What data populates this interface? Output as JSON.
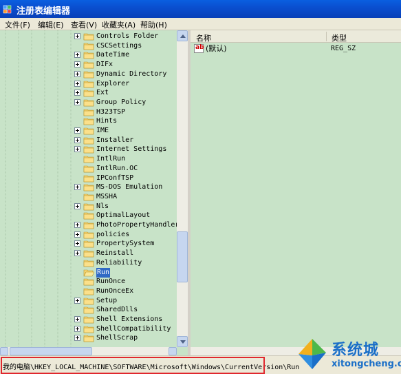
{
  "window": {
    "title": "注册表编辑器"
  },
  "menu": [
    "文件(F)",
    "编辑(E)",
    "查看(V)",
    "收藏夹(A)",
    "帮助(H)"
  ],
  "tree": {
    "items": [
      {
        "label": "Controls Folder",
        "expandable": true
      },
      {
        "label": "CSCSettings",
        "expandable": false
      },
      {
        "label": "DateTime",
        "expandable": true
      },
      {
        "label": "DIFx",
        "expandable": true
      },
      {
        "label": "Dynamic Directory",
        "expandable": true
      },
      {
        "label": "Explorer",
        "expandable": true
      },
      {
        "label": "Ext",
        "expandable": true
      },
      {
        "label": "Group Policy",
        "expandable": true
      },
      {
        "label": "H323TSP",
        "expandable": false
      },
      {
        "label": "Hints",
        "expandable": false
      },
      {
        "label": "IME",
        "expandable": true
      },
      {
        "label": "Installer",
        "expandable": true
      },
      {
        "label": "Internet Settings",
        "expandable": true
      },
      {
        "label": "IntlRun",
        "expandable": false
      },
      {
        "label": "IntlRun.OC",
        "expandable": false
      },
      {
        "label": "IPConfTSP",
        "expandable": false
      },
      {
        "label": "MS-DOS Emulation",
        "expandable": true
      },
      {
        "label": "MSSHA",
        "expandable": false
      },
      {
        "label": "Nls",
        "expandable": true
      },
      {
        "label": "OptimalLayout",
        "expandable": false
      },
      {
        "label": "PhotoPropertyHandler",
        "expandable": true
      },
      {
        "label": "policies",
        "expandable": true
      },
      {
        "label": "PropertySystem",
        "expandable": true
      },
      {
        "label": "Reinstall",
        "expandable": true
      },
      {
        "label": "Reliability",
        "expandable": false
      },
      {
        "label": "Run",
        "expandable": false,
        "selected": true
      },
      {
        "label": "RunOnce",
        "expandable": false
      },
      {
        "label": "RunOnceEx",
        "expandable": false
      },
      {
        "label": "Setup",
        "expandable": true
      },
      {
        "label": "SharedDlls",
        "expandable": false
      },
      {
        "label": "Shell Extensions",
        "expandable": true
      },
      {
        "label": "ShellCompatibility",
        "expandable": true
      },
      {
        "label": "ShellScrap",
        "expandable": true
      }
    ]
  },
  "list": {
    "columns": [
      "名称",
      "类型"
    ],
    "rows": [
      {
        "name": "(默认)",
        "type": "REG_SZ",
        "icon": "string-value-icon"
      }
    ]
  },
  "status": {
    "path": "我的电脑\\HKEY_LOCAL_MACHINE\\SOFTWARE\\Microsoft\\Windows\\CurrentVersion\\Run"
  },
  "watermark": {
    "cn": "系统城",
    "en": "xitongcheng.com"
  },
  "colors": {
    "pane_background": "#c8e3c8",
    "selection": "#316ac5",
    "titlebar": "#0a4fd0",
    "highlight": "#e0282e"
  }
}
